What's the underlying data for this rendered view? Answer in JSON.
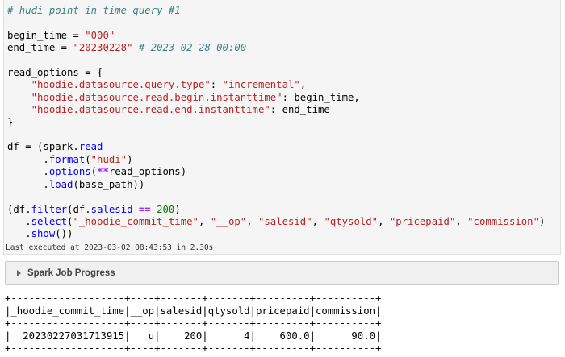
{
  "code": {
    "lines": [
      [
        {
          "t": "# hudi point in time query #1",
          "c": "cm"
        }
      ],
      [],
      [
        {
          "t": "begin_time = "
        },
        {
          "t": "\"000\"",
          "c": "st"
        }
      ],
      [
        {
          "t": "end_time = "
        },
        {
          "t": "\"20230228\"",
          "c": "st"
        },
        {
          "t": " "
        },
        {
          "t": "# 2023-02-28 00:00",
          "c": "cm"
        }
      ],
      [],
      [
        {
          "t": "read_options = {"
        }
      ],
      [
        {
          "t": "    "
        },
        {
          "t": "\"hoodie.datasource.query.type\"",
          "c": "st"
        },
        {
          "t": ": "
        },
        {
          "t": "\"incremental\"",
          "c": "st"
        },
        {
          "t": ","
        }
      ],
      [
        {
          "t": "    "
        },
        {
          "t": "\"hoodie.datasource.read.begin.instanttime\"",
          "c": "st"
        },
        {
          "t": ": begin_time,"
        }
      ],
      [
        {
          "t": "    "
        },
        {
          "t": "\"hoodie.datasource.read.end.instanttime\"",
          "c": "st"
        },
        {
          "t": ": end_time"
        }
      ],
      [
        {
          "t": "}"
        }
      ],
      [],
      [
        {
          "t": "df = (spark."
        },
        {
          "t": "read",
          "c": "fn"
        }
      ],
      [
        {
          "t": "      ."
        },
        {
          "t": "format",
          "c": "fn"
        },
        {
          "t": "("
        },
        {
          "t": "\"hudi\"",
          "c": "st"
        },
        {
          "t": ")"
        }
      ],
      [
        {
          "t": "      ."
        },
        {
          "t": "options",
          "c": "fn"
        },
        {
          "t": "("
        },
        {
          "t": "**",
          "c": "kw"
        },
        {
          "t": "read_options)"
        }
      ],
      [
        {
          "t": "      ."
        },
        {
          "t": "load",
          "c": "fn"
        },
        {
          "t": "(base_path))"
        }
      ],
      [],
      [
        {
          "t": "(df."
        },
        {
          "t": "filter",
          "c": "fn"
        },
        {
          "t": "(df."
        },
        {
          "t": "salesid",
          "c": "fn"
        },
        {
          "t": " "
        },
        {
          "t": "==",
          "c": "kw"
        },
        {
          "t": " "
        },
        {
          "t": "200",
          "c": "nm"
        },
        {
          "t": ")"
        }
      ],
      [
        {
          "t": "   ."
        },
        {
          "t": "select",
          "c": "fn"
        },
        {
          "t": "("
        },
        {
          "t": "\"_hoodie_commit_time\"",
          "c": "st"
        },
        {
          "t": ", "
        },
        {
          "t": "\"__op\"",
          "c": "st"
        },
        {
          "t": ", "
        },
        {
          "t": "\"salesid\"",
          "c": "st"
        },
        {
          "t": ", "
        },
        {
          "t": "\"qtysold\"",
          "c": "st"
        },
        {
          "t": ", "
        },
        {
          "t": "\"pricepaid\"",
          "c": "st"
        },
        {
          "t": ", "
        },
        {
          "t": "\"commission\"",
          "c": "st"
        },
        {
          "t": ")"
        }
      ],
      [
        {
          "t": "   ."
        },
        {
          "t": "show",
          "c": "fn"
        },
        {
          "t": "())"
        }
      ]
    ]
  },
  "status": "Last executed at 2023-03-02 08:43:53 in 2.30s",
  "job_progress": {
    "label": "Spark Job Progress"
  },
  "output": {
    "text": "+-------------------+----+-------+-------+---------+----------+\n|_hoodie_commit_time|__op|salesid|qtysold|pricepaid|commission|\n+-------------------+----+-------+-------+---------+----------+\n|  20230227031713915|   u|    200|      4|    600.0|      90.0|\n+-------------------+----+-------+-------+---------+----------+"
  },
  "colors": {
    "comment": "#408080",
    "string": "#ba2121",
    "operator": "#aa22ff",
    "attribute": "#0000ff",
    "number": "#008000",
    "cell_background": "#f5f5f5",
    "job_bar_background": "#f0f0f0"
  }
}
